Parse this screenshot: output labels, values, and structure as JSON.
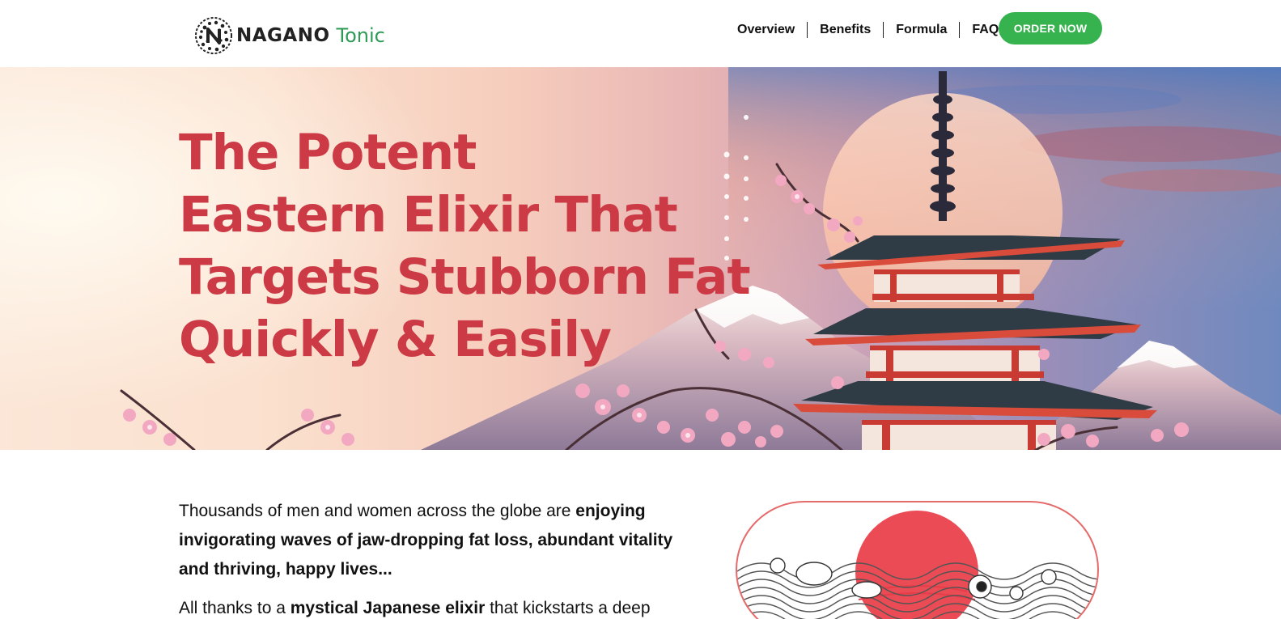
{
  "brand": {
    "word1": "NAGANO",
    "word2": "Tonic",
    "green": "#2e9a55",
    "icon": "leaf-n-logo-icon"
  },
  "nav": {
    "items": [
      {
        "label": "Overview"
      },
      {
        "label": "Benefits"
      },
      {
        "label": "Formula"
      },
      {
        "label": "FAQ"
      }
    ],
    "order_label": "ORDER NOW",
    "order_color": "#36b34e"
  },
  "hero": {
    "lines": [
      "The Potent",
      "Eastern Elixir That",
      "Targets Stubborn Fat",
      "Quickly & Easily"
    ],
    "title_color": "#cc3a45"
  },
  "intro": {
    "p1_plain": "Thousands of men and women across the globe are ",
    "p1_bold": "enjoying invigorating waves of jaw-dropping fat loss, abundant vitality and thriving, happy lives...",
    "p2_plain1": "All thanks to a ",
    "p2_bold": "mystical Japanese elixir",
    "p2_plain2": " that kickstarts a deep"
  }
}
